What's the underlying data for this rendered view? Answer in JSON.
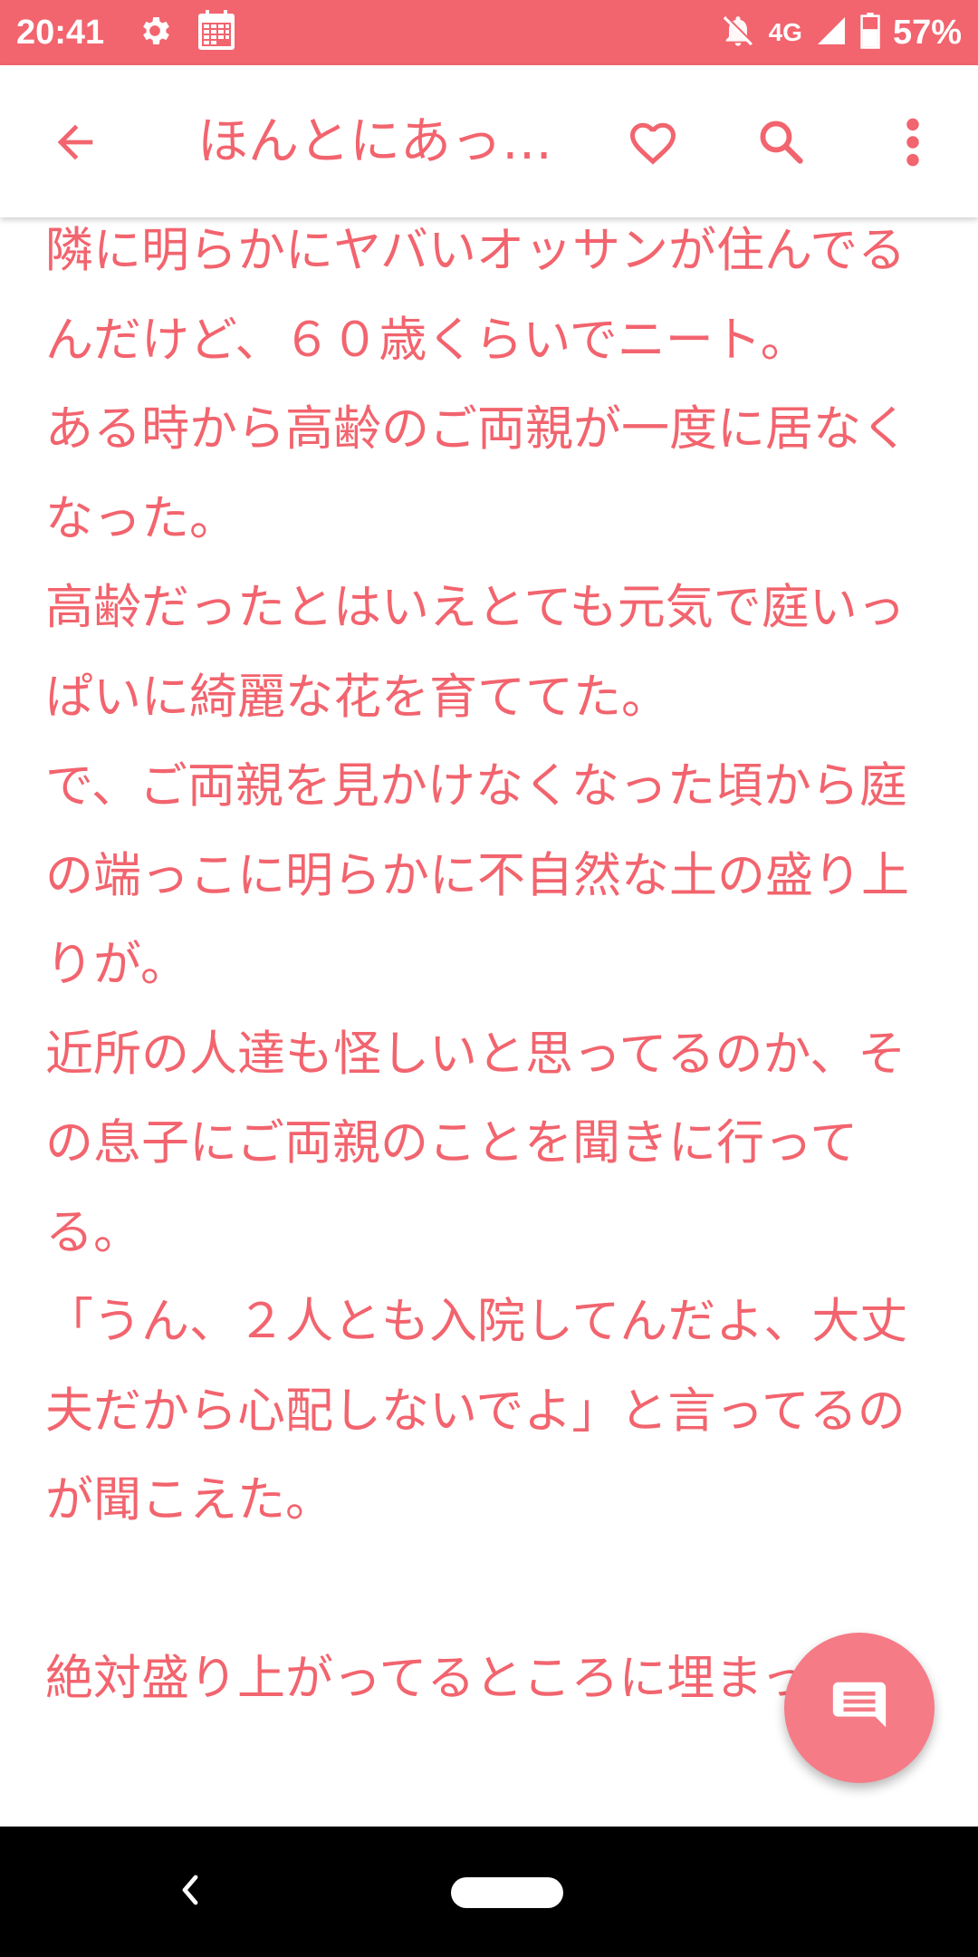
{
  "status_bar": {
    "time": "20:41",
    "network": "4G",
    "battery": "57%",
    "icons": [
      "settings-icon",
      "calendar-icon",
      "notifications-off-icon",
      "signal-icon",
      "battery-icon"
    ]
  },
  "toolbar": {
    "title": "ほんとにあっ…",
    "icons": [
      "back-arrow-icon",
      "heart-icon",
      "search-icon",
      "more-vert-icon"
    ]
  },
  "article": {
    "text": "隣に明らかにヤバいオッサンが住んでるんだけど、６０歳くらいでニート。\nある時から高齢のご両親が一度に居なくなった。\n高齢だったとはいえとても元気で庭いっぱいに綺麗な花を育ててた。\nで、ご両親を見かけなくなった頃から庭の端っこに明らかに不自然な土の盛り上りが。\n近所の人達も怪しいと思ってるのか、その息子にご両親のことを聞きに行ってる。\n「うん、２人とも入院してんだよ、大丈夫だから心配しないでよ」と言ってるのが聞こえた。\n\n絶対盛り上がってるところに埋まっ"
  },
  "fab": {
    "icon": "comment-icon"
  },
  "nav_bar": {
    "icons": [
      "nav-back-icon",
      "home-pill-icon"
    ]
  },
  "colors": {
    "accent": "#f2646e",
    "fab": "#f57b86",
    "nav": "#000000"
  }
}
